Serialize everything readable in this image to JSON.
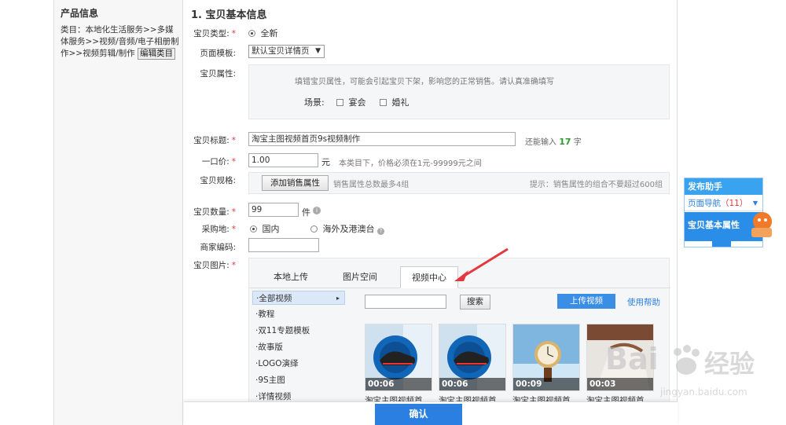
{
  "sidebar": {
    "title": "产品信息",
    "category": "类目：本地化生活服务>>多媒体服务>>视频/音频/电子相册制作>>视频剪辑/制作",
    "edit_label": "编辑类目"
  },
  "section": {
    "title": "1. 宝贝基本信息"
  },
  "fields": {
    "type_label": "宝贝类型:",
    "type_value": "全新",
    "template_label": "页面模板:",
    "template_value": "默认宝贝详情页",
    "attr_label": "宝贝属性:",
    "attr_hint": "填错宝贝属性，可能会引起宝贝下架，影响您的正常销售。请认真准确填写",
    "scene_label": "场景:",
    "scene_opt1": "宴会",
    "scene_opt2": "婚礼",
    "title_label": "宝贝标题:",
    "title_value": "淘宝主图视频首页9s视频制作",
    "title_remaining_prefix": "还能输入",
    "title_remaining_count": "17",
    "title_remaining_unit": "字",
    "price_label": "一口价:",
    "price_value": "1.00",
    "price_unit": "元",
    "price_hint": "本类目下，价格必须在1元-99999元之间",
    "spec_label": "宝贝规格:",
    "spec_button": "添加销售属性",
    "spec_hint": "销售属性总数最多4组",
    "spec_tip": "提示：销售属性的组合不要超过600组",
    "qty_label": "宝贝数量:",
    "qty_value": "99",
    "qty_unit": "件",
    "origin_label": "采购地:",
    "origin_opt1": "国内",
    "origin_opt2": "海外及港澳台",
    "code_label": "商家编码:",
    "image_label": "宝贝图片:"
  },
  "image_panel": {
    "tabs": [
      "本地上传",
      "图片空间",
      "视频中心"
    ],
    "active_tab": 2,
    "categories": [
      "全部视频",
      "教程",
      "双11专题模板",
      "故事版",
      "LOGO演绎",
      "9S主图",
      "详情视频"
    ],
    "search_button": "搜索",
    "upload_button": "上传视频",
    "help_link": "使用帮助",
    "videos": [
      {
        "duration": "00:06",
        "caption": "淘宝主图视频首..."
      },
      {
        "duration": "00:06",
        "caption": "淘宝主图视频首..."
      },
      {
        "duration": "00:09",
        "caption": "淘宝主图视频首..."
      },
      {
        "duration": "00:03",
        "caption": "淘宝主图视频首..."
      }
    ]
  },
  "confirm_label": "确认",
  "helper": {
    "title": "发布助手",
    "nav_label": "页面导航",
    "nav_count": "（11）",
    "current": "宝贝基本属性"
  },
  "watermark": {
    "brand": "Bai",
    "brand2": "经验",
    "url": "jingyan.baidu.com"
  },
  "colors": {
    "accent": "#2a7fe0",
    "required": "#e4393c",
    "count_green": "#2a9d2a",
    "arrow": "#e4393c"
  }
}
